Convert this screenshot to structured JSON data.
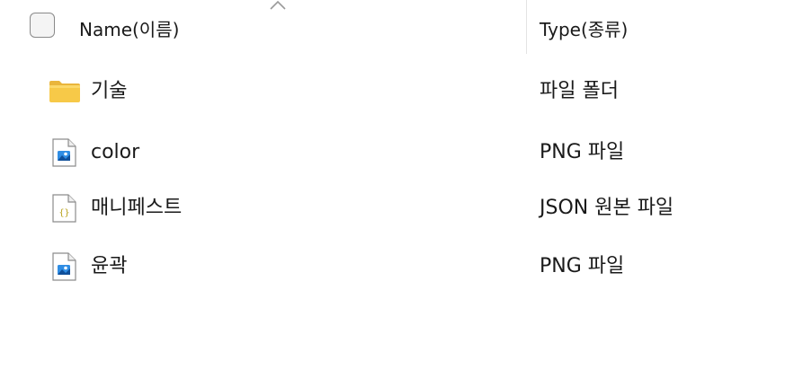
{
  "header": {
    "name_column": "Name(이름)",
    "type_column": "Type(종류)"
  },
  "files": [
    {
      "name": "기술",
      "type": "파일 폴더",
      "icon": "folder-icon"
    },
    {
      "name": "color",
      "type": "PNG 파일",
      "icon": "image-file-icon"
    },
    {
      "name": "매니페스트",
      "type": "JSON 원본 파일",
      "icon": "json-file-icon"
    },
    {
      "name": "윤곽",
      "type": "PNG 파일",
      "icon": "image-file-icon"
    }
  ],
  "colors": {
    "folder": "#f4c430",
    "image_accent": "#1f7ad1",
    "json_accent": "#b8a21c"
  }
}
